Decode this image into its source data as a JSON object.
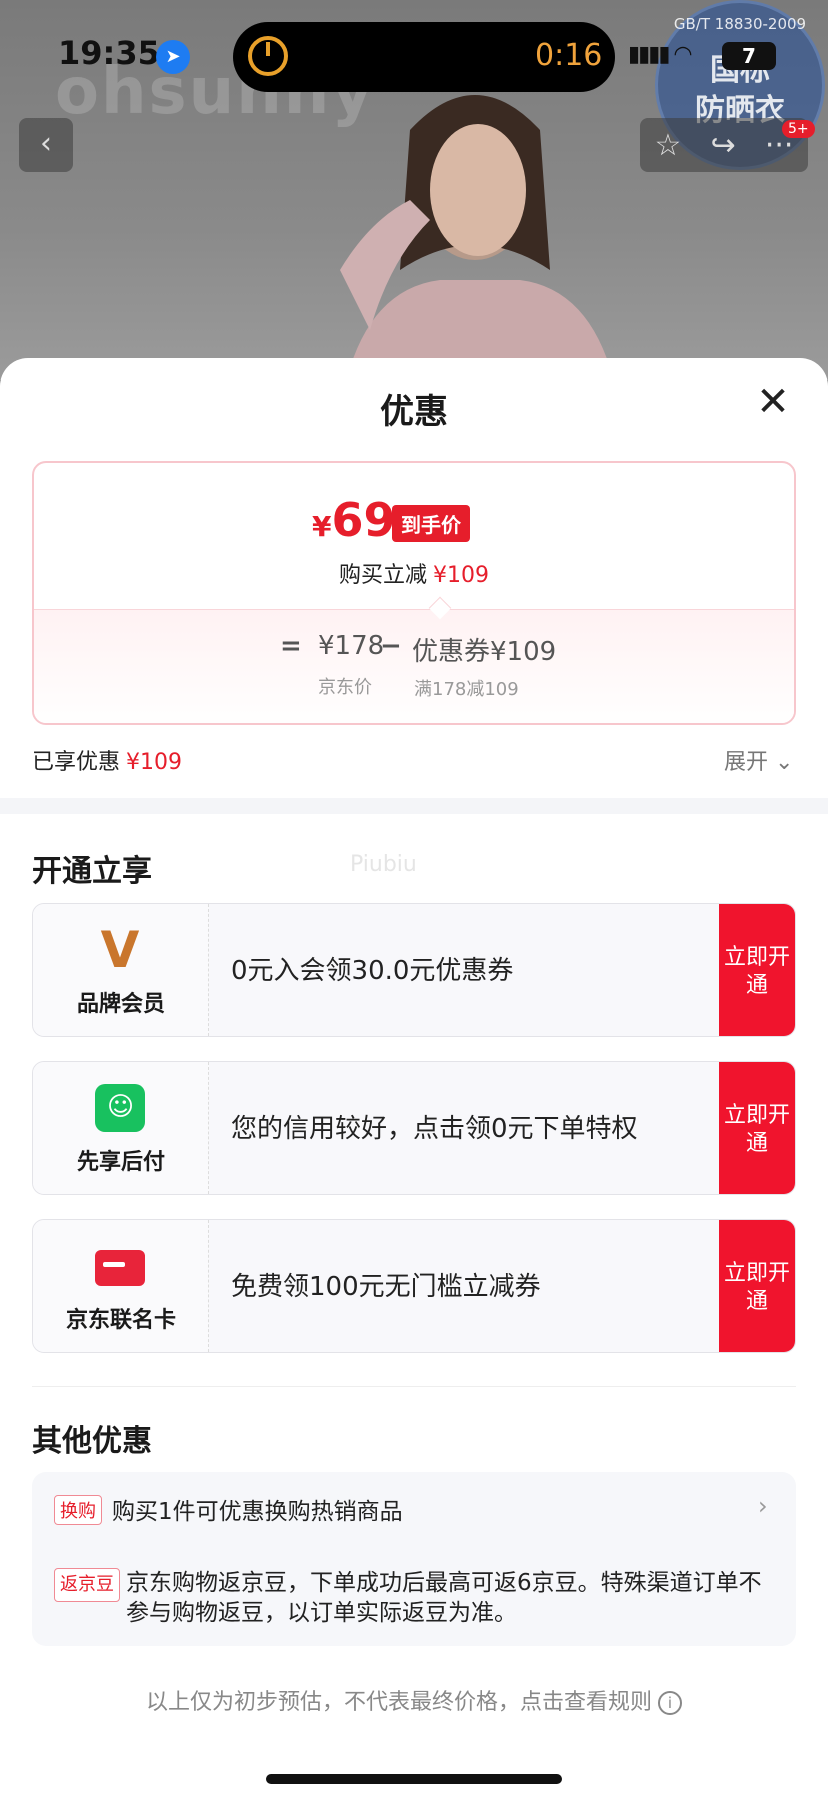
{
  "status_bar": {
    "time": "19:35",
    "timer": "0:16",
    "battery": "7"
  },
  "background": {
    "brand_ghost": "ohsunny",
    "seal_std": "GB/T 18830-2009",
    "seal_line1": "国标",
    "seal_line2": "防晒衣",
    "cart_badge": "5+"
  },
  "sheet": {
    "title": "优惠",
    "price_card": {
      "final_price_symbol": "¥",
      "final_price": "69",
      "final_tag": "到手价",
      "instant_cut_label": "购买立减",
      "instant_cut_value": "¥109",
      "eq": "=",
      "jd_price": "¥178",
      "minus": "−",
      "coupon": "优惠券¥109",
      "jd_price_label": "京东价",
      "coupon_rule": "满178减109"
    },
    "enjoyed_label": "已享优惠",
    "enjoyed_value": "¥109",
    "expand_label": "展开 ⌄",
    "section_open": "开通立享",
    "watermark": "Piubiu",
    "benefits": [
      {
        "name": "品牌会员",
        "desc": "0元入会领30.0元优惠券",
        "action": "立即开通",
        "icon": "brand-v-icon"
      },
      {
        "name": "先享后付",
        "desc": "您的信用较好，点击领0元下单特权",
        "action": "立即开通",
        "icon": "shopping-bag-icon"
      },
      {
        "name": "京东联名卡",
        "desc": "免费领100元无门槛立减券",
        "action": "立即开通",
        "icon": "card-icon"
      }
    ],
    "section_other": "其他优惠",
    "other": [
      {
        "tag": "换购",
        "text": "购买1件可优惠换购热销商品"
      },
      {
        "tag": "返京豆",
        "text": "京东购物返京豆，下单成功后最高可返6京豆。特殊渠道订单不参与购物返豆，以订单实际返豆为准。"
      }
    ],
    "footnote": "以上仅为初步预估，不代表最终价格，点击查看规则"
  }
}
